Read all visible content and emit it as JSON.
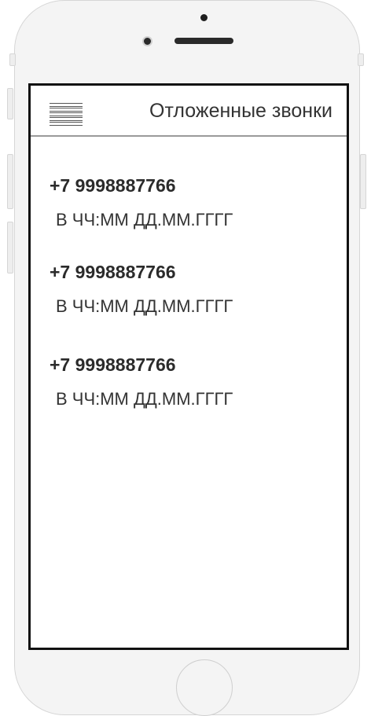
{
  "header": {
    "title": "Отложенные звонки",
    "menu_icon": "hamburger-menu-icon"
  },
  "calls": [
    {
      "phone": "+7 9998887766",
      "time": "В ЧЧ:ММ ДД.ММ.ГГГГ"
    },
    {
      "phone": "+7 9998887766",
      "time": "В ЧЧ:ММ ДД.ММ.ГГГГ"
    },
    {
      "phone": "+7 9998887766",
      "time": "В ЧЧ:ММ ДД.ММ.ГГГГ"
    }
  ]
}
